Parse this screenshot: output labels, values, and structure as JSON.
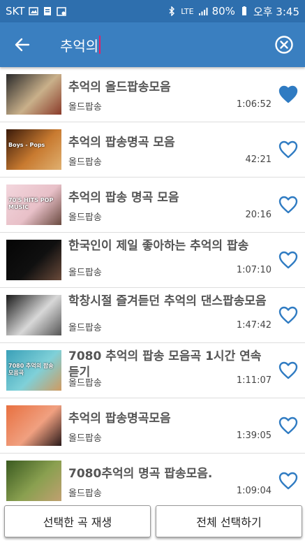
{
  "status_bar": {
    "carrier": "SKT",
    "network": "LTE",
    "battery": "80%",
    "time": "오후 3:45",
    "icons": [
      "image-icon",
      "document-icon",
      "calendar-icon",
      "bluetooth-icon",
      "signal-icon",
      "battery-icon"
    ]
  },
  "header": {
    "back_icon": "arrow-left-icon",
    "search_query": "추억의",
    "clear_icon": "close-circle-icon"
  },
  "colors": {
    "status_bar": "#2e6fae",
    "app_bar": "#3a7fc0",
    "heart": "#2f7bc2",
    "caret": "#e91e63"
  },
  "songs": [
    {
      "title": "추억의 올드팝송모음",
      "channel": "올드팝송",
      "duration": "1:06:52",
      "favorite": true
    },
    {
      "title": "추억의 팝송명곡 모음",
      "channel": "올드팝송",
      "duration": "42:21",
      "favorite": false
    },
    {
      "title": "추억의 팝송 명곡 모음",
      "channel": "올드팝송",
      "duration": "20:16",
      "favorite": false
    },
    {
      "title": "한국인이 제일 좋아하는 추억의 팝송",
      "channel": "올드팝송",
      "duration": "1:07:10",
      "favorite": false
    },
    {
      "title": "학창시절 즐겨듣던 추억의 댄스팝송모음",
      "channel": "올드팝송",
      "duration": "1:47:42",
      "favorite": false
    },
    {
      "title": "7080 추억의 팝송 모음곡 1시간 연속듣기",
      "channel": "올드팝송",
      "duration": "1:11:07",
      "favorite": false
    },
    {
      "title": "추억의 팝송명곡모음",
      "channel": "올드팝송",
      "duration": "1:39:05",
      "favorite": false
    },
    {
      "title": "7080추억의  명곡 팝송모음.",
      "channel": "올드팝송",
      "duration": "1:09:04",
      "favorite": false
    }
  ],
  "thumbnails": [
    {
      "label": "",
      "colors": [
        "#2a2a2a",
        "#c9b08a",
        "#8a3b2a"
      ]
    },
    {
      "label": "Boys - Pops",
      "colors": [
        "#3a1a0a",
        "#c87a30",
        "#e0b070"
      ]
    },
    {
      "label": "70'S HITS POP MUSIC",
      "colors": [
        "#f3d6dd",
        "#e8c0c8",
        "#6a4a40"
      ]
    },
    {
      "label": "",
      "colors": [
        "#050505",
        "#101010",
        "#6a4a3a"
      ]
    },
    {
      "label": "",
      "colors": [
        "#1a1a1a",
        "#d8d8d8",
        "#555555"
      ]
    },
    {
      "label": "7080 추억의 팝송 모음곡",
      "colors": [
        "#3aa0b8",
        "#7fd0d8",
        "#d09a60"
      ]
    },
    {
      "label": "",
      "colors": [
        "#e87040",
        "#f0a080",
        "#2a1a1a"
      ]
    },
    {
      "label": "",
      "colors": [
        "#3a5a20",
        "#8aa050",
        "#c0a070"
      ]
    }
  ],
  "footer": {
    "play_selected": "선택한 곡 재생",
    "select_all": "전체 선택하기"
  }
}
